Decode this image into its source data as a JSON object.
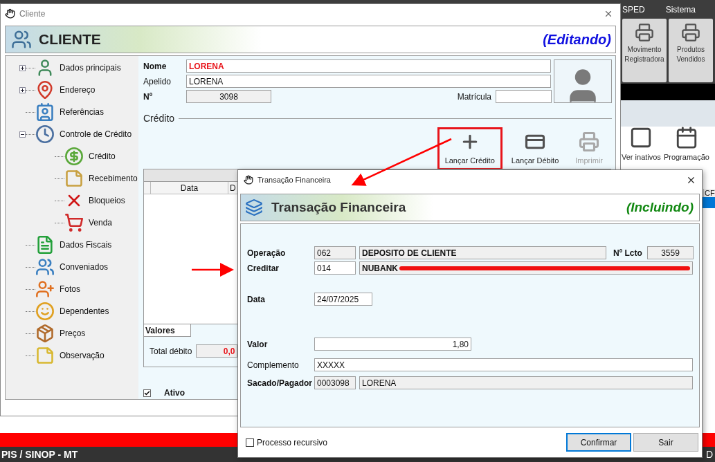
{
  "background_app": {
    "menu": [
      "SPED",
      "Sistema"
    ],
    "toolbar_top": [
      "Movimento Registradora",
      "Produtos Vendidos"
    ],
    "toolbar_bottom": [
      "Ver inativos",
      "Programação"
    ],
    "grid_header": "CF",
    "status_bar": [
      "PIS / SINOP - MT",
      "D"
    ]
  },
  "client_window": {
    "title": "Cliente",
    "header": {
      "title": "CLIENTE",
      "mode": "(Editando)"
    },
    "tree": [
      {
        "label": "Dados principais",
        "kind": "group",
        "expanded": false
      },
      {
        "label": "Endereço",
        "kind": "group",
        "expanded": false
      },
      {
        "label": "Referências",
        "kind": "leaf"
      },
      {
        "label": "Controle de Crédito",
        "kind": "group",
        "expanded": true,
        "children": [
          {
            "label": "Crédito"
          },
          {
            "label": "Recebimento"
          },
          {
            "label": "Bloqueios"
          },
          {
            "label": "Venda"
          }
        ]
      },
      {
        "label": "Dados Fiscais",
        "kind": "leaf"
      },
      {
        "label": "Conveniados",
        "kind": "leaf"
      },
      {
        "label": "Fotos",
        "kind": "leaf"
      },
      {
        "label": "Dependentes",
        "kind": "leaf"
      },
      {
        "label": "Preços",
        "kind": "leaf"
      },
      {
        "label": "Observação",
        "kind": "leaf"
      }
    ],
    "nome": {
      "label": "Nome",
      "value": "LORENA"
    },
    "apelido": {
      "label": "Apelido",
      "value": "LORENA"
    },
    "numero": {
      "label": "Nº",
      "value": "3098"
    },
    "matricula": {
      "label": "Matrícula"
    },
    "section": "Crédito",
    "actions": [
      {
        "label": "Lançar Crédito",
        "disabled": false,
        "highlighted": true
      },
      {
        "label": "Lançar Débito",
        "disabled": false,
        "highlighted": false
      },
      {
        "label": "Imprimir",
        "disabled": true,
        "highlighted": false
      }
    ],
    "grid": {
      "columns": [
        "Data",
        "D"
      ]
    },
    "totals": {
      "tab": "Valores",
      "label": "Total débito",
      "value": "0,0"
    },
    "ativo": {
      "label": "Ativo",
      "checked": true
    }
  },
  "transaction_dialog": {
    "title": "Transação Financeira",
    "header": {
      "title": "Transação Financeira",
      "mode": "(Incluindo)"
    },
    "operacao": {
      "label": "Operação",
      "code": "062",
      "name": "DEPOSITO DE CLIENTE"
    },
    "lcto": {
      "label": "Nº Lcto",
      "value": "3559"
    },
    "creditar": {
      "label": "Creditar",
      "code": "014",
      "name": "NUBANK",
      "redacted": true
    },
    "data": {
      "label": "Data",
      "value": "24/07/2025"
    },
    "valor": {
      "label": "Valor",
      "value": "1,80"
    },
    "complemento": {
      "label": "Complemento",
      "value": "XXXXX"
    },
    "sacado": {
      "label": "Sacado/Pagador",
      "code": "0003098",
      "name": "LORENA"
    },
    "recursive": {
      "label": "Processo recursivo",
      "checked": false
    },
    "buttons": [
      {
        "label": "Confirmar",
        "focused": true
      },
      {
        "label": "Sair",
        "focused": false
      }
    ]
  }
}
